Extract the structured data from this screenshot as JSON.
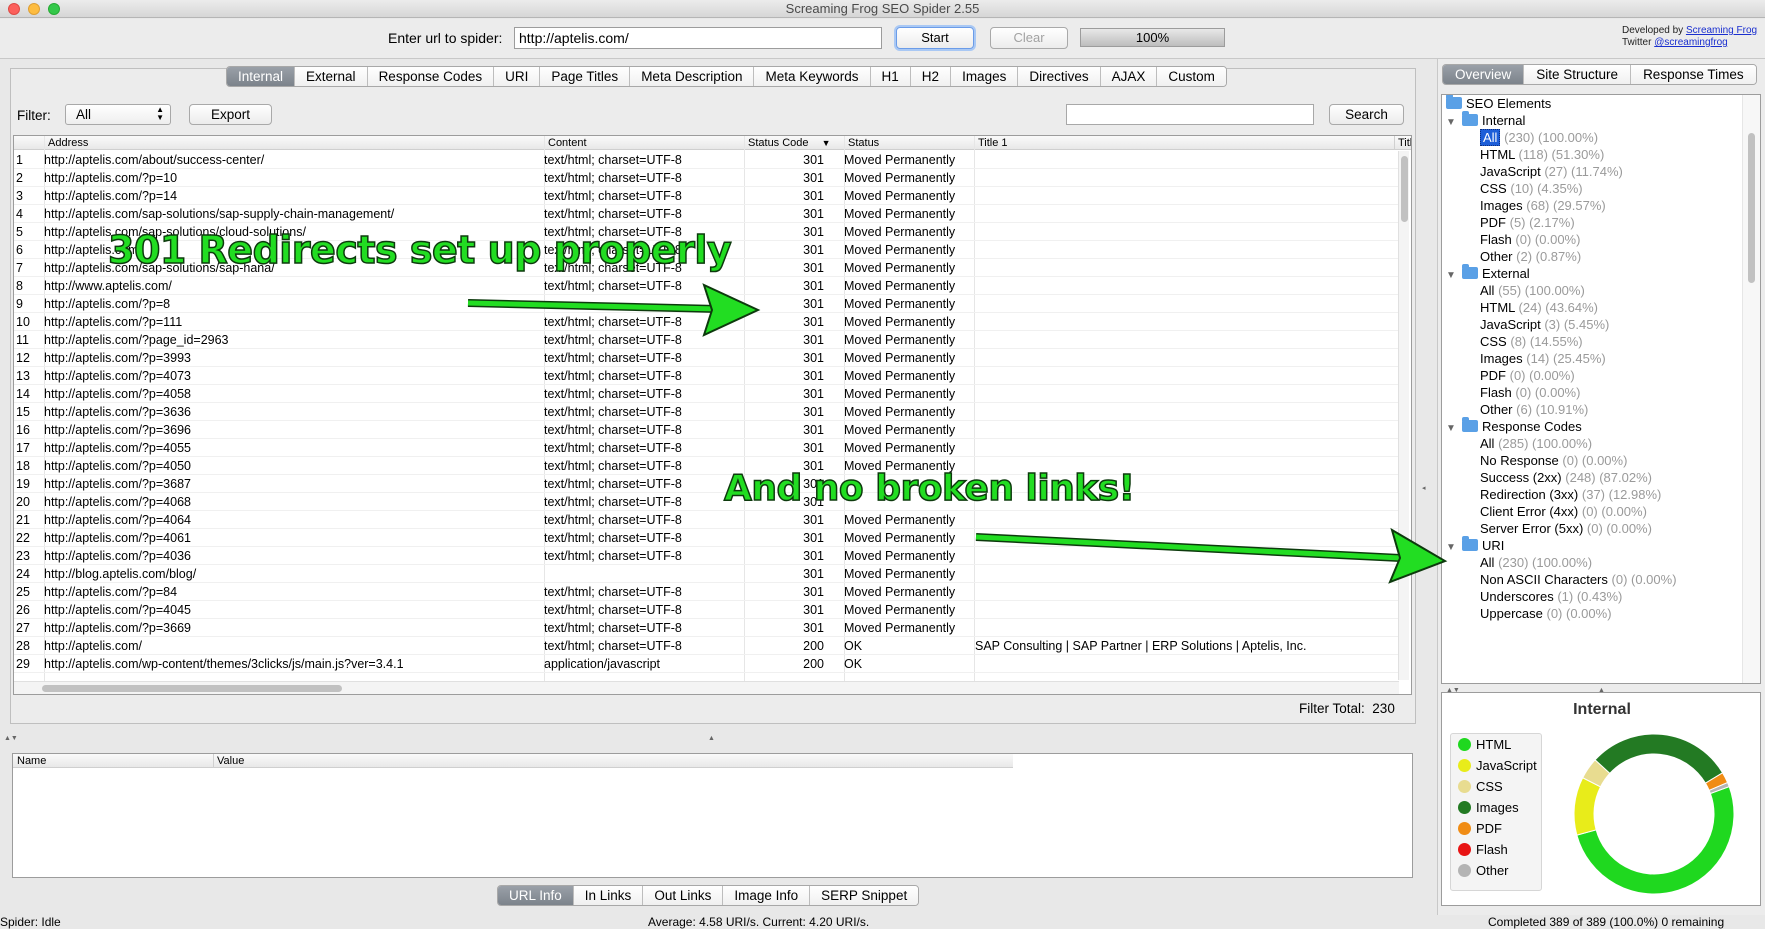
{
  "window": {
    "title": "Screaming Frog SEO Spider 2.55"
  },
  "toolbar": {
    "url_label": "Enter url to spider:",
    "url_value": "http://aptelis.com/",
    "start_label": "Start",
    "clear_label": "Clear",
    "progress": "100%",
    "progress_fraction": 1.0,
    "developed_by": "Developed by",
    "developer": "Screaming Frog",
    "twitter_label": "Twitter",
    "twitter_handle": "@screamingfrog"
  },
  "main_tabs": [
    "Internal",
    "External",
    "Response Codes",
    "URI",
    "Page Titles",
    "Meta Description",
    "Meta Keywords",
    "H1",
    "H2",
    "Images",
    "Directives",
    "AJAX",
    "Custom"
  ],
  "filter": {
    "label": "Filter:",
    "value": "All",
    "export_label": "Export",
    "search_value": "",
    "search_label": "Search"
  },
  "table": {
    "columns": [
      "Address",
      "Content",
      "Status Code",
      "Status",
      "Title 1",
      "Title"
    ],
    "rows": [
      [
        "1",
        "http://aptelis.com/about/success-center/",
        "text/html; charset=UTF-8",
        "301",
        "Moved Permanently",
        ""
      ],
      [
        "2",
        "http://aptelis.com/?p=10",
        "text/html; charset=UTF-8",
        "301",
        "Moved Permanently",
        ""
      ],
      [
        "3",
        "http://aptelis.com/?p=14",
        "text/html; charset=UTF-8",
        "301",
        "Moved Permanently",
        ""
      ],
      [
        "4",
        "http://aptelis.com/sap-solutions/sap-supply-chain-management/",
        "text/html; charset=UTF-8",
        "301",
        "Moved Permanently",
        ""
      ],
      [
        "5",
        "http://aptelis.com/sap-solutions/cloud-solutions/",
        "text/html; charset=UTF-8",
        "301",
        "Moved Permanently",
        ""
      ],
      [
        "6",
        "http://aptelis.com/",
        "text/html; charset=UTF-8",
        "301",
        "Moved Permanently",
        ""
      ],
      [
        "7",
        "http://aptelis.com/sap-solutions/sap-hana/",
        "text/html; charset=UTF-8",
        "301",
        "Moved Permanently",
        ""
      ],
      [
        "8",
        "http://www.aptelis.com/",
        "text/html; charset=UTF-8",
        "301",
        "Moved Permanently",
        ""
      ],
      [
        "9",
        "http://aptelis.com/?p=8",
        "",
        "301",
        "Moved Permanently",
        ""
      ],
      [
        "10",
        "http://aptelis.com/?p=111",
        "text/html; charset=UTF-8",
        "301",
        "Moved Permanently",
        ""
      ],
      [
        "11",
        "http://aptelis.com/?page_id=2963",
        "text/html; charset=UTF-8",
        "301",
        "Moved Permanently",
        ""
      ],
      [
        "12",
        "http://aptelis.com/?p=3993",
        "text/html; charset=UTF-8",
        "301",
        "Moved Permanently",
        ""
      ],
      [
        "13",
        "http://aptelis.com/?p=4073",
        "text/html; charset=UTF-8",
        "301",
        "Moved Permanently",
        ""
      ],
      [
        "14",
        "http://aptelis.com/?p=4058",
        "text/html; charset=UTF-8",
        "301",
        "Moved Permanently",
        ""
      ],
      [
        "15",
        "http://aptelis.com/?p=3636",
        "text/html; charset=UTF-8",
        "301",
        "Moved Permanently",
        ""
      ],
      [
        "16",
        "http://aptelis.com/?p=3696",
        "text/html; charset=UTF-8",
        "301",
        "Moved Permanently",
        ""
      ],
      [
        "17",
        "http://aptelis.com/?p=4055",
        "text/html; charset=UTF-8",
        "301",
        "Moved Permanently",
        ""
      ],
      [
        "18",
        "http://aptelis.com/?p=4050",
        "text/html; charset=UTF-8",
        "301",
        "Moved Permanently",
        ""
      ],
      [
        "19",
        "http://aptelis.com/?p=3687",
        "text/html; charset=UTF-8",
        "301",
        "",
        ""
      ],
      [
        "20",
        "http://aptelis.com/?p=4068",
        "text/html; charset=UTF-8",
        "301",
        "",
        ""
      ],
      [
        "21",
        "http://aptelis.com/?p=4064",
        "text/html; charset=UTF-8",
        "301",
        "Moved Permanently",
        ""
      ],
      [
        "22",
        "http://aptelis.com/?p=4061",
        "text/html; charset=UTF-8",
        "301",
        "Moved Permanently",
        ""
      ],
      [
        "23",
        "http://aptelis.com/?p=4036",
        "text/html; charset=UTF-8",
        "301",
        "Moved Permanently",
        ""
      ],
      [
        "24",
        "http://blog.aptelis.com/blog/",
        "",
        "301",
        "Moved Permanently",
        ""
      ],
      [
        "25",
        "http://aptelis.com/?p=84",
        "text/html; charset=UTF-8",
        "301",
        "Moved Permanently",
        ""
      ],
      [
        "26",
        "http://aptelis.com/?p=4045",
        "text/html; charset=UTF-8",
        "301",
        "Moved Permanently",
        ""
      ],
      [
        "27",
        "http://aptelis.com/?p=3669",
        "text/html; charset=UTF-8",
        "301",
        "Moved Permanently",
        ""
      ],
      [
        "28",
        "http://aptelis.com/",
        "text/html; charset=UTF-8",
        "200",
        "OK",
        "SAP Consulting | SAP Partner | ERP Solutions | Aptelis, Inc."
      ],
      [
        "29",
        "http://aptelis.com/wp-content/themes/3clicks/js/main.js?ver=3.4.1",
        "application/javascript",
        "200",
        "OK",
        ""
      ]
    ]
  },
  "filter_total": {
    "label": "Filter Total:",
    "value": "230"
  },
  "bottom": {
    "columns": [
      "Name",
      "Value"
    ],
    "tabs": [
      "URL Info",
      "In Links",
      "Out Links",
      "Image Info",
      "SERP Snippet"
    ]
  },
  "statusbar": {
    "left": "Spider: Idle",
    "center": "Average: 4.58 URI/s. Current: 4.20 URI/s.",
    "right": "Completed 389 of 389 (100.0%) 0 remaining"
  },
  "right_tabs": [
    "Overview",
    "Site Structure",
    "Response Times"
  ],
  "tree": [
    {
      "label": "SEO Elements",
      "level": 0,
      "folder": true
    },
    {
      "label": "Internal",
      "level": 1,
      "folder": true,
      "expand": true
    },
    {
      "label": "All",
      "meta": "(230) (100.00%)",
      "level": 2,
      "selected": true
    },
    {
      "label": "HTML",
      "meta": "(118) (51.30%)",
      "level": 2
    },
    {
      "label": "JavaScript",
      "meta": "(27) (11.74%)",
      "level": 2
    },
    {
      "label": "CSS",
      "meta": "(10) (4.35%)",
      "level": 2
    },
    {
      "label": "Images",
      "meta": "(68) (29.57%)",
      "level": 2
    },
    {
      "label": "PDF",
      "meta": "(5) (2.17%)",
      "level": 2
    },
    {
      "label": "Flash",
      "meta": "(0) (0.00%)",
      "level": 2
    },
    {
      "label": "Other",
      "meta": "(2) (0.87%)",
      "level": 2
    },
    {
      "label": "External",
      "level": 1,
      "folder": true,
      "expand": true
    },
    {
      "label": "All",
      "meta": "(55) (100.00%)",
      "level": 2
    },
    {
      "label": "HTML",
      "meta": "(24) (43.64%)",
      "level": 2
    },
    {
      "label": "JavaScript",
      "meta": "(3) (5.45%)",
      "level": 2
    },
    {
      "label": "CSS",
      "meta": "(8) (14.55%)",
      "level": 2
    },
    {
      "label": "Images",
      "meta": "(14) (25.45%)",
      "level": 2
    },
    {
      "label": "PDF",
      "meta": "(0) (0.00%)",
      "level": 2
    },
    {
      "label": "Flash",
      "meta": "(0) (0.00%)",
      "level": 2
    },
    {
      "label": "Other",
      "meta": "(6) (10.91%)",
      "level": 2
    },
    {
      "label": "Response Codes",
      "level": 1,
      "folder": true,
      "expand": true
    },
    {
      "label": "All",
      "meta": "(285) (100.00%)",
      "level": 2
    },
    {
      "label": "No Response",
      "meta": "(0) (0.00%)",
      "level": 2
    },
    {
      "label": "Success (2xx)",
      "meta": "(248) (87.02%)",
      "level": 2
    },
    {
      "label": "Redirection (3xx)",
      "meta": "(37) (12.98%)",
      "level": 2
    },
    {
      "label": "Client Error (4xx)",
      "meta": "(0) (0.00%)",
      "level": 2
    },
    {
      "label": "Server Error (5xx)",
      "meta": "(0) (0.00%)",
      "level": 2
    },
    {
      "label": "URI",
      "level": 1,
      "folder": true,
      "expand": true
    },
    {
      "label": "All",
      "meta": "(230) (100.00%)",
      "level": 2
    },
    {
      "label": "Non ASCII Characters",
      "meta": "(0) (0.00%)",
      "level": 2
    },
    {
      "label": "Underscores",
      "meta": "(1) (0.43%)",
      "level": 2
    },
    {
      "label": "Uppercase",
      "meta": "(0) (0.00%)",
      "level": 2
    }
  ],
  "chart_data": {
    "type": "pie",
    "title": "Internal",
    "categories": [
      "HTML",
      "JavaScript",
      "CSS",
      "Images",
      "PDF",
      "Flash",
      "Other"
    ],
    "values": [
      118,
      27,
      10,
      68,
      5,
      0,
      2
    ],
    "colors": [
      "#1fd81f",
      "#e8ec1a",
      "#e8dc90",
      "#237a23",
      "#f08c14",
      "#e81414",
      "#b4b4b4"
    ]
  },
  "annotations": {
    "redirects": "301 Redirects set up properly",
    "no_broken": "And no broken links!"
  },
  "icons": {
    "folder": "folder-icon",
    "expand": "disclosure-triangle-icon"
  }
}
